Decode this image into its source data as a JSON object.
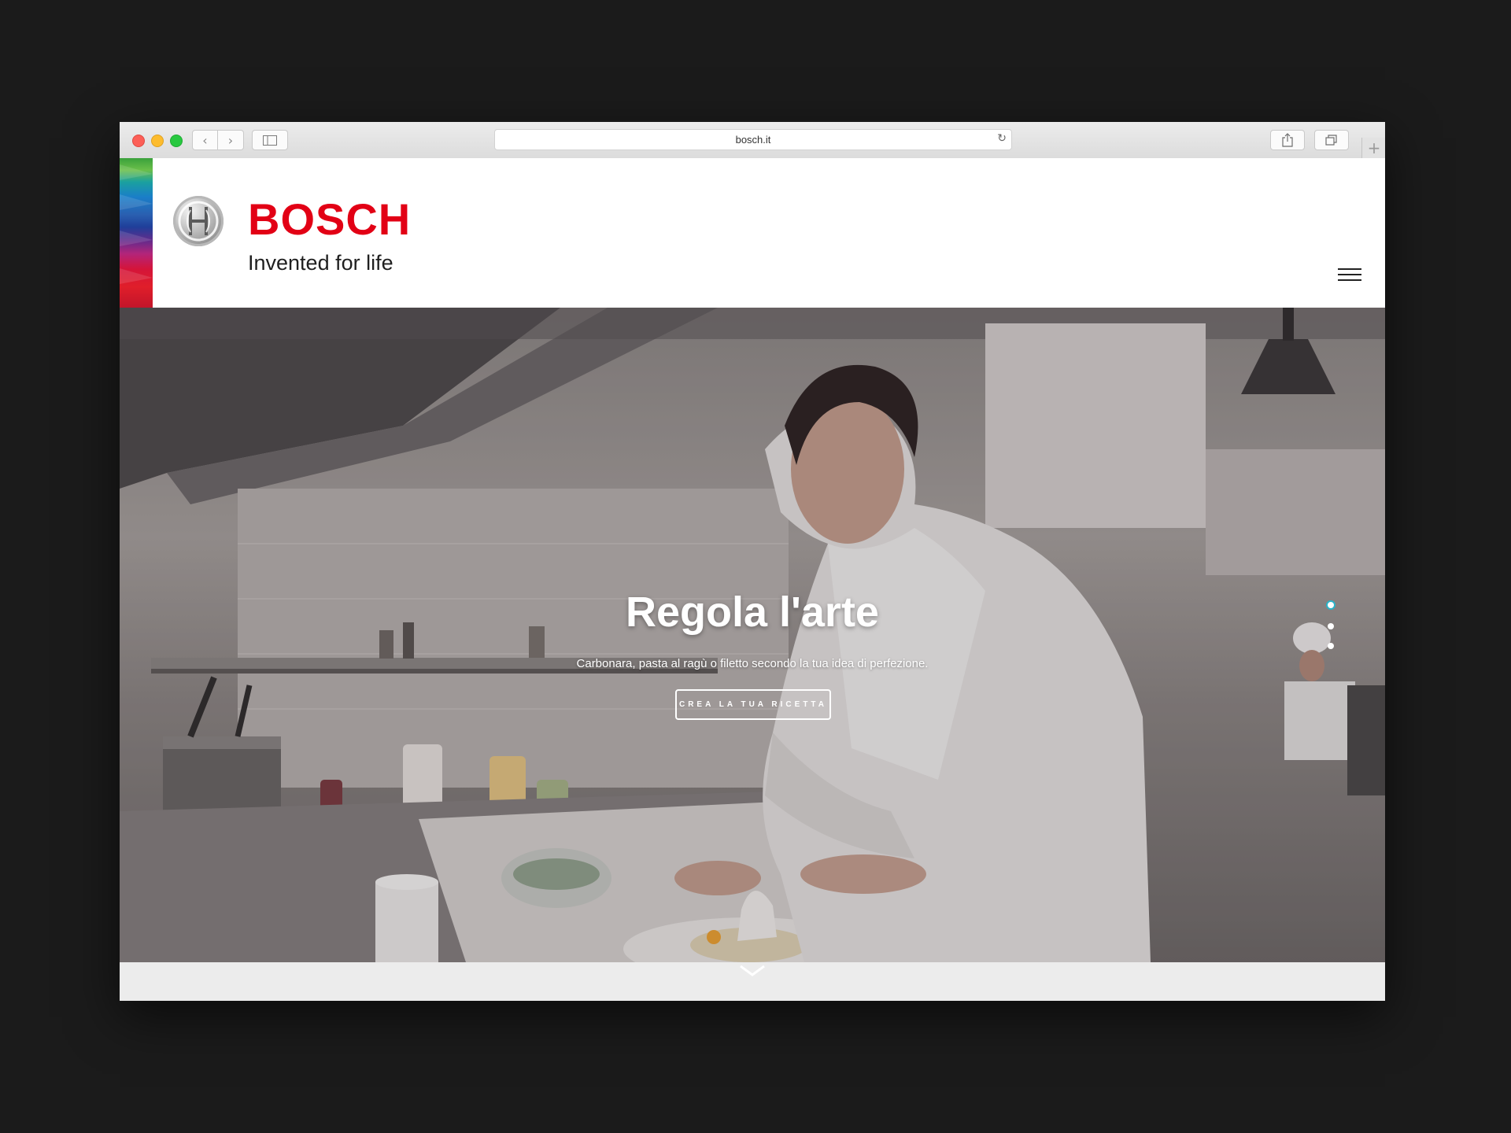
{
  "browser": {
    "url": "bosch.it",
    "reload_icon": "↻",
    "back_icon": "‹",
    "forward_icon": "›",
    "new_tab_icon": "+"
  },
  "header": {
    "brand": "BOSCH",
    "tagline": "Invented for life",
    "menu_icon": "hamburger-menu-icon"
  },
  "hero": {
    "title": "Regola l'arte",
    "subtitle": "Carbonara, pasta al ragù o filetto secondo la tua idea di perfezione.",
    "cta_label": "CREA LA TUA RICETTA",
    "slides_total": 3,
    "active_slide": 1,
    "scroll_icon": "chevron-down-icon"
  },
  "colors": {
    "brand_red": "#e20015",
    "accent_teal": "#2ab3c9",
    "page_background": "#1b1b1b"
  }
}
